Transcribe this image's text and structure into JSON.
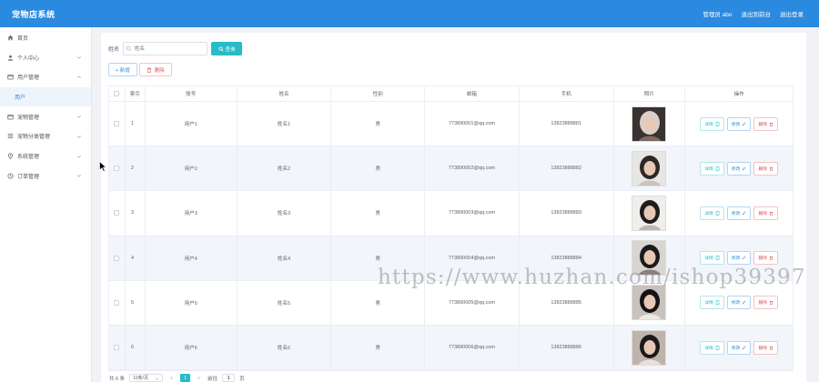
{
  "app": {
    "title": "宠物店系统",
    "user_label": "管理员 abo",
    "front_link": "退出到前台",
    "logout": "退出登录"
  },
  "sidebar": {
    "items": [
      {
        "label": "首页",
        "icon": "home-icon",
        "expandable": false
      },
      {
        "label": "个人中心",
        "icon": "user-icon",
        "expandable": true
      },
      {
        "label": "用户管理",
        "icon": "folder-icon",
        "expandable": true
      },
      {
        "label": "用户",
        "icon": "",
        "expandable": false,
        "sub": true
      },
      {
        "label": "宠物管理",
        "icon": "folder-icon",
        "expandable": true
      },
      {
        "label": "宠物分类管理",
        "icon": "list-icon",
        "expandable": true
      },
      {
        "label": "系统管理",
        "icon": "location-icon",
        "expandable": true
      },
      {
        "label": "订单管理",
        "icon": "clock-icon",
        "expandable": true
      }
    ]
  },
  "search": {
    "label": "姓名",
    "placeholder": "姓名",
    "button": "查询"
  },
  "actions": {
    "add": "+ 新增",
    "delete": "删除"
  },
  "table": {
    "headers": [
      "",
      "索引",
      "账号",
      "姓名",
      "性别",
      "邮箱",
      "手机",
      "照片",
      "操作"
    ],
    "rows": [
      {
        "index": "1",
        "account": "用户1",
        "name": "姓名1",
        "gender": "男",
        "email": "773890001@qq.com",
        "phone": "13823888881"
      },
      {
        "index": "2",
        "account": "用户2",
        "name": "姓名2",
        "gender": "男",
        "email": "773890002@qq.com",
        "phone": "13823888882"
      },
      {
        "index": "3",
        "account": "用户3",
        "name": "姓名3",
        "gender": "男",
        "email": "773890003@qq.com",
        "phone": "13823888883"
      },
      {
        "index": "4",
        "account": "用户4",
        "name": "姓名4",
        "gender": "男",
        "email": "773890004@qq.com",
        "phone": "13823888884"
      },
      {
        "index": "5",
        "account": "用户5",
        "name": "姓名5",
        "gender": "男",
        "email": "773890005@qq.com",
        "phone": "13823888885"
      },
      {
        "index": "6",
        "account": "用户6",
        "name": "姓名6",
        "gender": "男",
        "email": "773890006@qq.com",
        "phone": "13823888886"
      }
    ],
    "ops": {
      "detail": "详情",
      "edit": "修改",
      "remove": "删除"
    }
  },
  "pager": {
    "total": "共 6 条",
    "page_size": "10条/页",
    "current_page": "1",
    "goto_prefix": "前往",
    "goto_value": "1",
    "goto_suffix": "页"
  },
  "watermark": "https://www.huzhan.com/ishop39397",
  "colors": {
    "topbar": "#2a8ae0",
    "accent": "#26bcc9",
    "danger": "#e05555"
  }
}
